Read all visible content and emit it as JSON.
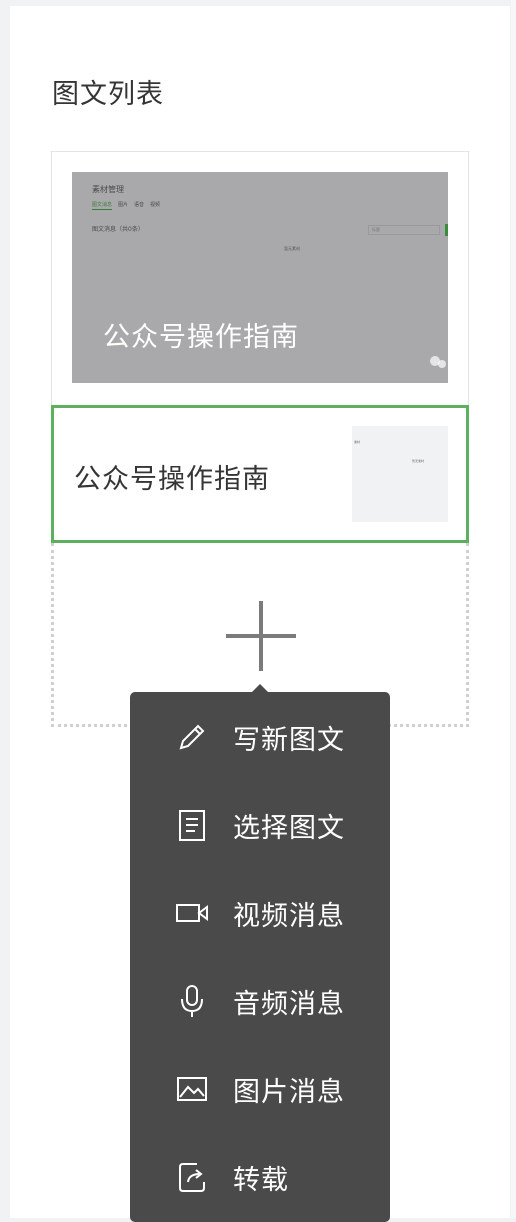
{
  "header": {
    "title": "图文列表"
  },
  "articles": [
    {
      "title": "公众号操作指南",
      "cover_preview": {
        "heading": "素材管理",
        "tabs": [
          "图文消息",
          "图片",
          "语音",
          "视频"
        ],
        "subtitle": "图文消息（共0条）",
        "search_placeholder": "标题",
        "center_text": "暂无素材"
      }
    },
    {
      "title": "公众号操作指南",
      "selected": true,
      "thumb_preview": {
        "line1": "素材",
        "line2": "暂无素材"
      }
    }
  ],
  "menu": {
    "items": [
      {
        "label": "写新图文",
        "icon": "pencil-icon"
      },
      {
        "label": "选择图文",
        "icon": "document-icon"
      },
      {
        "label": "视频消息",
        "icon": "video-camera-icon"
      },
      {
        "label": "音频消息",
        "icon": "microphone-icon"
      },
      {
        "label": "图片消息",
        "icon": "image-icon"
      },
      {
        "label": "转载",
        "icon": "share-icon"
      }
    ]
  },
  "colors": {
    "accent": "#5eaf5e",
    "menu_bg": "#4a4a4a",
    "text": "#353535"
  }
}
